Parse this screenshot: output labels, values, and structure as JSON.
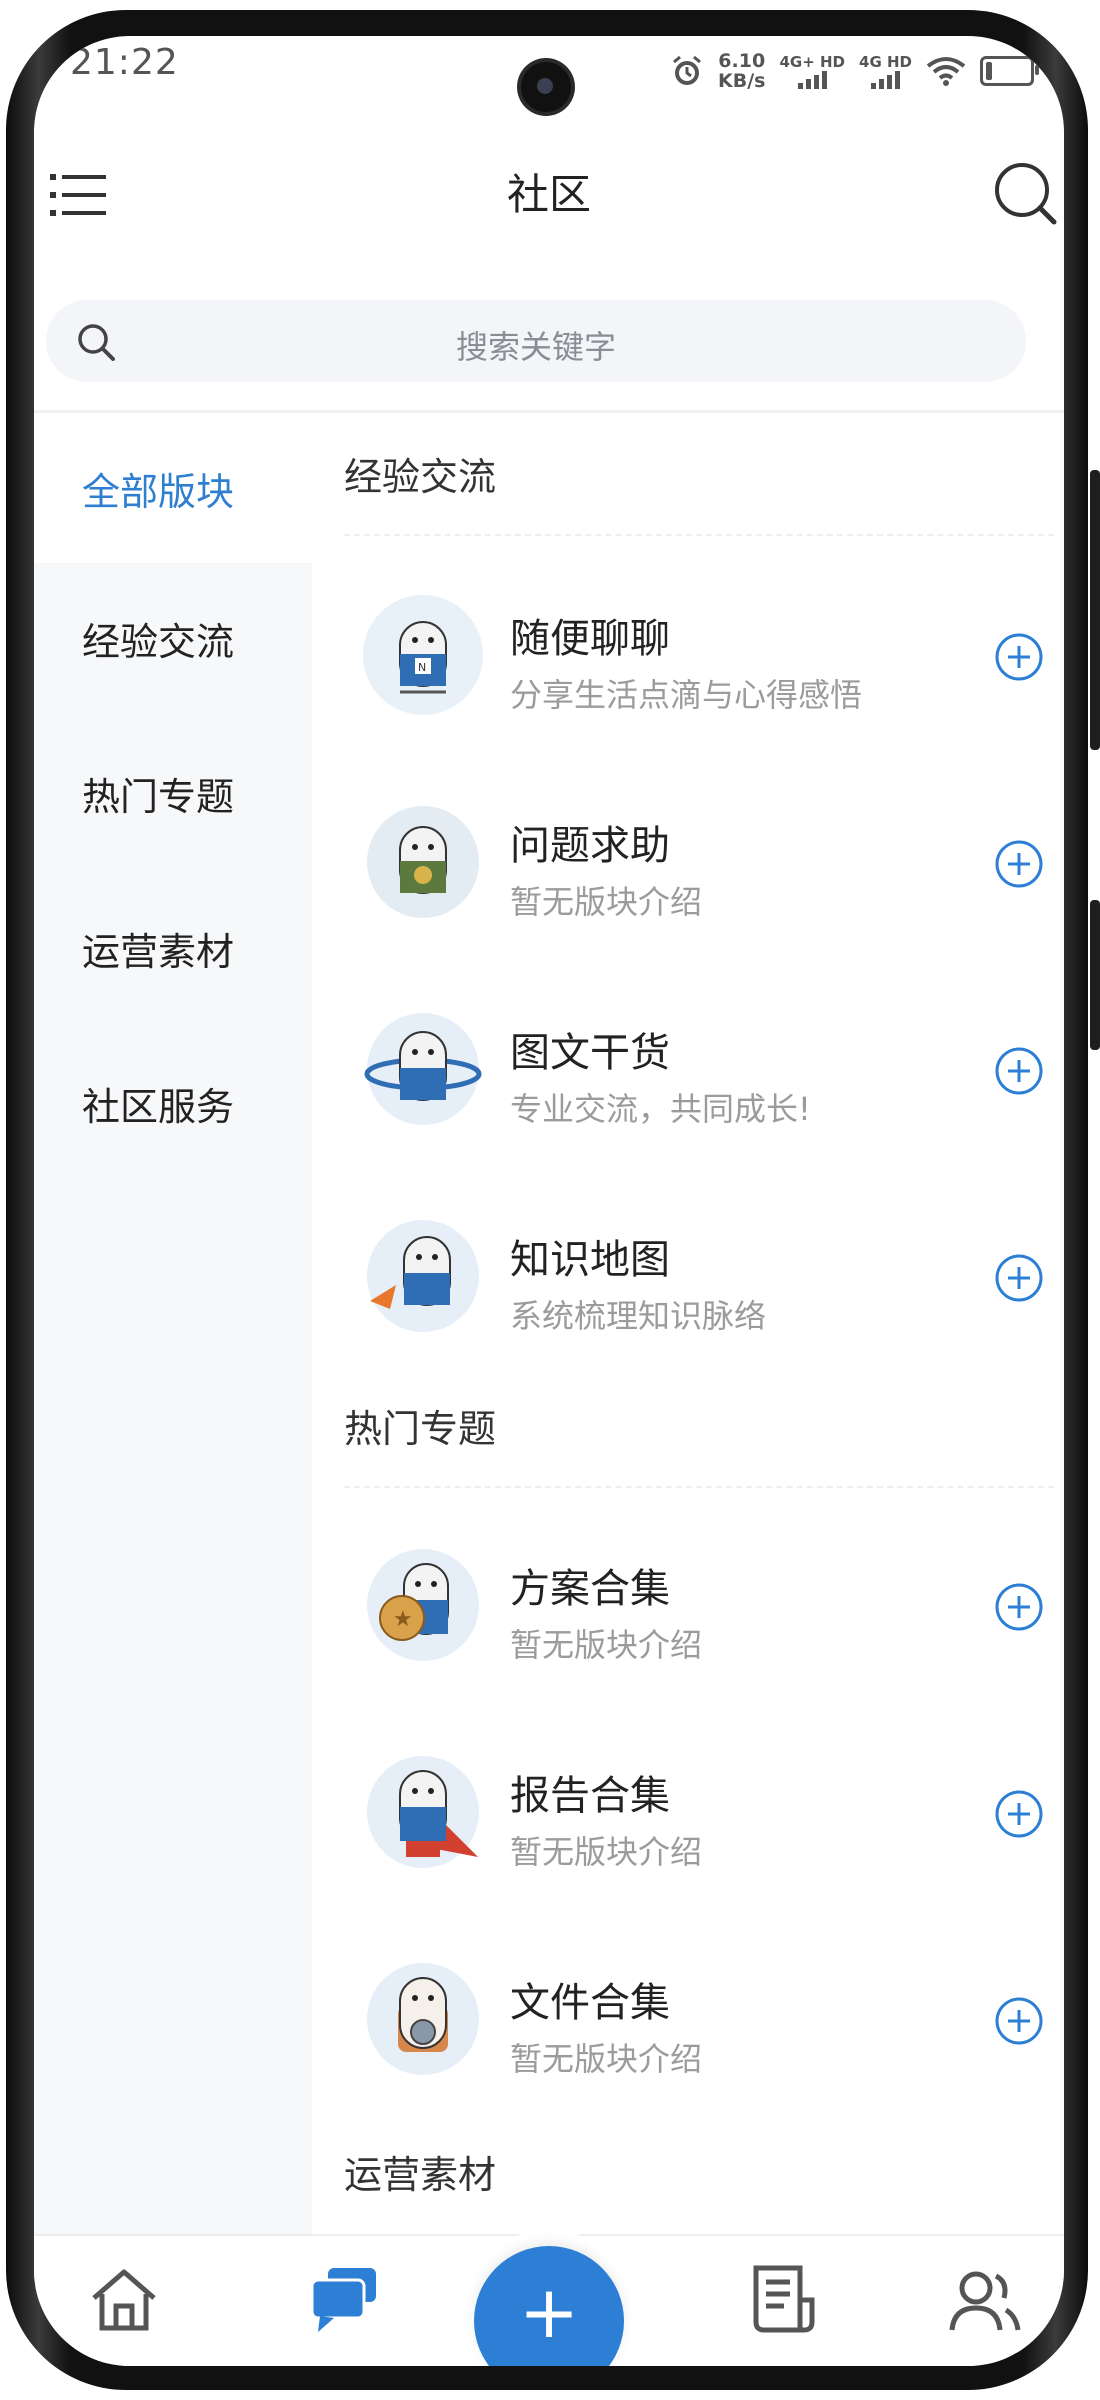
{
  "status_bar": {
    "time": "21:22",
    "speed_value": "6.10",
    "speed_unit": "KB/s",
    "sim1": "4G+ HD",
    "sim2": "4G HD",
    "icons": [
      "alarm-icon",
      "signal-icon",
      "wifi-icon",
      "battery-icon"
    ]
  },
  "header": {
    "title": "社区",
    "menu_icon": "menu-icon",
    "search_icon": "search-icon"
  },
  "search": {
    "placeholder": "搜索关键字"
  },
  "left_nav": {
    "items": [
      {
        "label": "全部版块",
        "active": true
      },
      {
        "label": "经验交流",
        "active": false
      },
      {
        "label": "热门专题",
        "active": false
      },
      {
        "label": "运营素材",
        "active": false
      },
      {
        "label": "社区服务",
        "active": false
      }
    ]
  },
  "sections": [
    {
      "title": "经验交流",
      "boards": [
        {
          "name": "随便聊聊",
          "desc": "分享生活点滴与心得感悟"
        },
        {
          "name": "问题求助",
          "desc": "暂无版块介绍"
        },
        {
          "name": "图文干货",
          "desc": "专业交流，共同成长!"
        },
        {
          "name": "知识地图",
          "desc": "系统梳理知识脉络"
        }
      ]
    },
    {
      "title": "热门专题",
      "boards": [
        {
          "name": "方案合集",
          "desc": "暂无版块介绍"
        },
        {
          "name": "报告合集",
          "desc": "暂无版块介绍"
        },
        {
          "name": "文件合集",
          "desc": "暂无版块介绍"
        }
      ]
    },
    {
      "title": "运营素材",
      "boards": []
    }
  ],
  "bottom_nav": {
    "tabs": [
      "home-icon",
      "community-chat-icon",
      "add-icon",
      "articles-icon",
      "profile-icon"
    ],
    "active_tab": "community-chat-icon"
  },
  "colors": {
    "accent": "#2c7fd4",
    "text": "#222222",
    "muted": "#9b9b9b",
    "nav_bg": "#f7f8fa"
  }
}
